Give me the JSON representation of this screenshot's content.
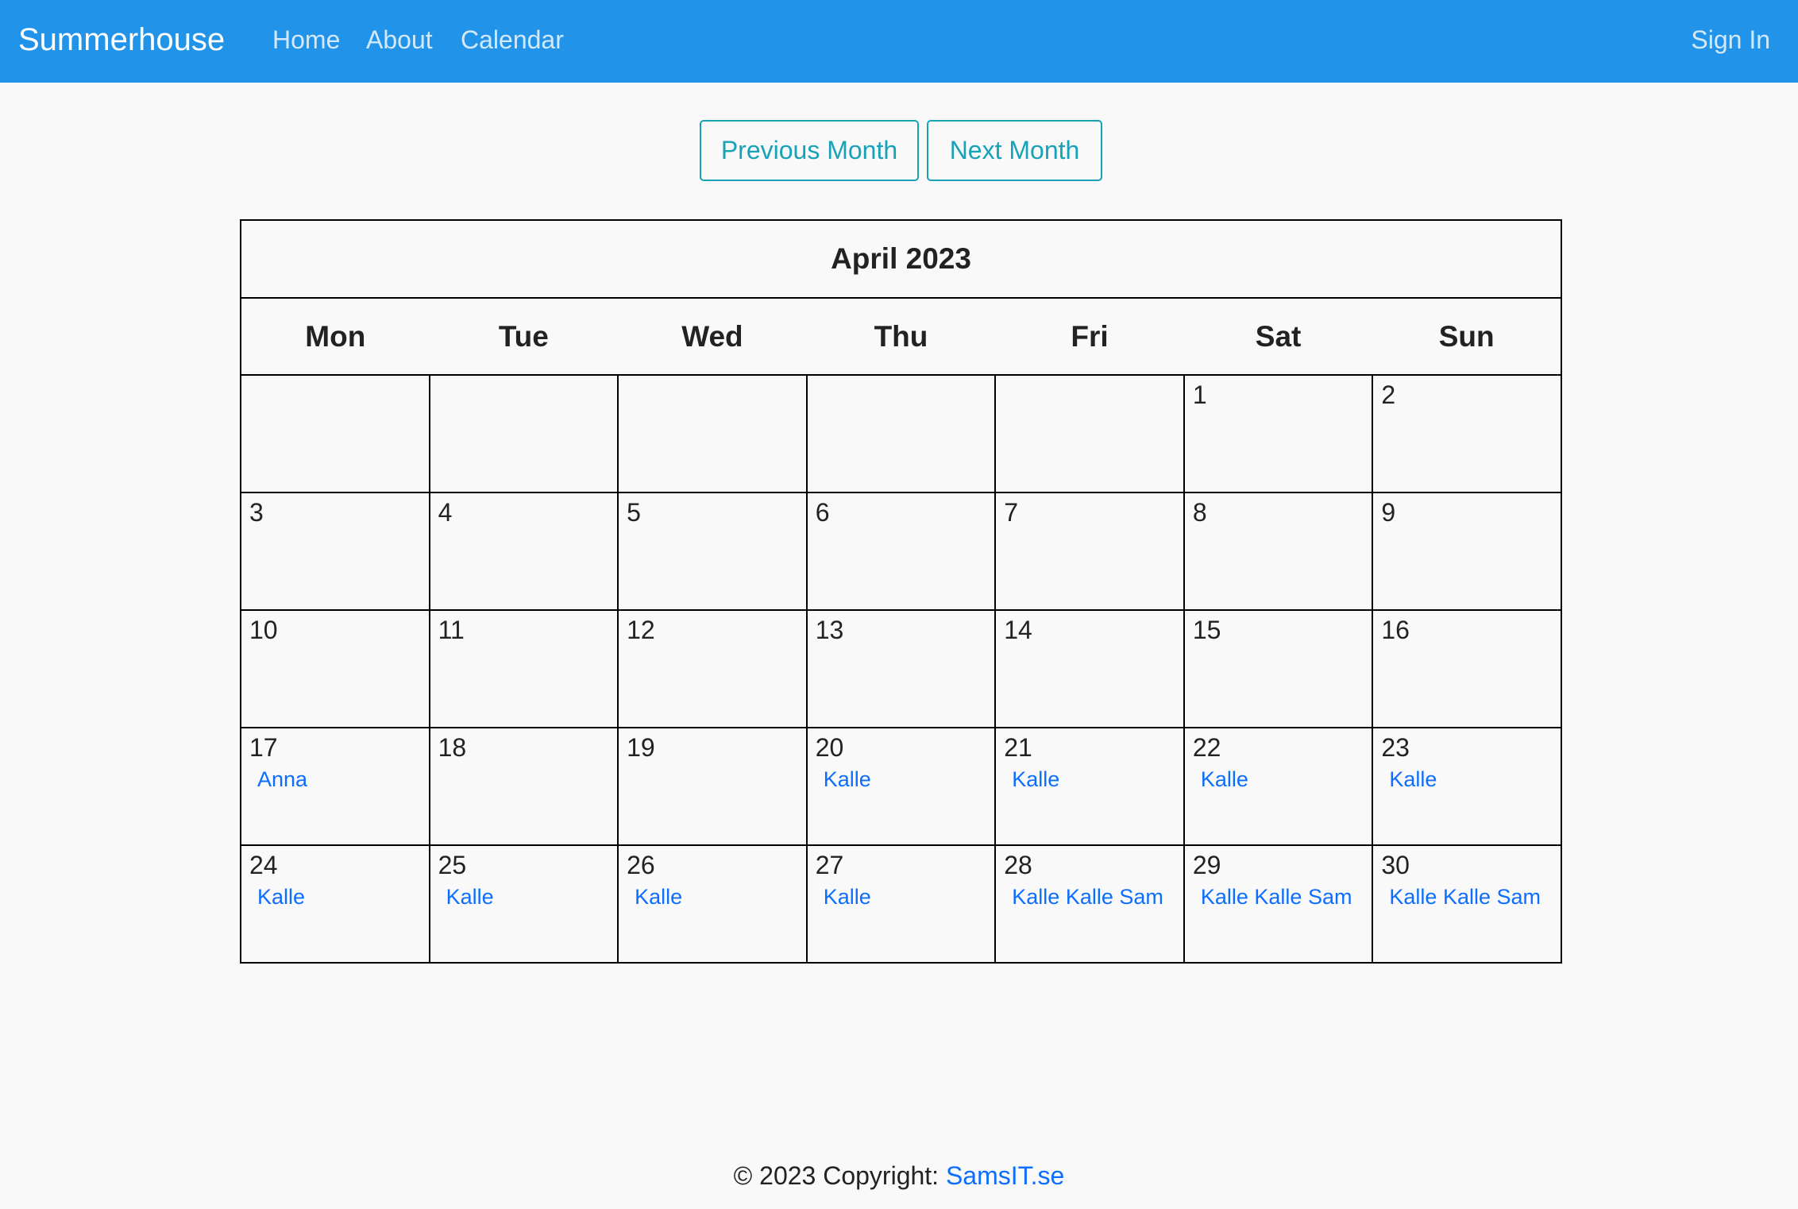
{
  "navbar": {
    "brand": "Summerhouse",
    "links": [
      "Home",
      "About",
      "Calendar"
    ],
    "sign_in": "Sign In",
    "background_color": "#2193e8"
  },
  "month_nav": {
    "previous_label": "Previous Month",
    "next_label": "Next Month",
    "button_color": "#17a2b8"
  },
  "calendar": {
    "title": "April 2023",
    "weekdays": [
      "Mon",
      "Tue",
      "Wed",
      "Thu",
      "Fri",
      "Sat",
      "Sun"
    ],
    "weeks": [
      [
        {
          "day": "",
          "bookings": []
        },
        {
          "day": "",
          "bookings": []
        },
        {
          "day": "",
          "bookings": []
        },
        {
          "day": "",
          "bookings": []
        },
        {
          "day": "",
          "bookings": []
        },
        {
          "day": "1",
          "bookings": []
        },
        {
          "day": "2",
          "bookings": []
        }
      ],
      [
        {
          "day": "3",
          "bookings": []
        },
        {
          "day": "4",
          "bookings": []
        },
        {
          "day": "5",
          "bookings": []
        },
        {
          "day": "6",
          "bookings": []
        },
        {
          "day": "7",
          "bookings": []
        },
        {
          "day": "8",
          "bookings": []
        },
        {
          "day": "9",
          "bookings": []
        }
      ],
      [
        {
          "day": "10",
          "bookings": []
        },
        {
          "day": "11",
          "bookings": []
        },
        {
          "day": "12",
          "bookings": []
        },
        {
          "day": "13",
          "bookings": []
        },
        {
          "day": "14",
          "bookings": []
        },
        {
          "day": "15",
          "bookings": []
        },
        {
          "day": "16",
          "bookings": []
        }
      ],
      [
        {
          "day": "17",
          "bookings": [
            "Anna"
          ]
        },
        {
          "day": "18",
          "bookings": []
        },
        {
          "day": "19",
          "bookings": []
        },
        {
          "day": "20",
          "bookings": [
            "Kalle"
          ]
        },
        {
          "day": "21",
          "bookings": [
            "Kalle"
          ]
        },
        {
          "day": "22",
          "bookings": [
            "Kalle"
          ]
        },
        {
          "day": "23",
          "bookings": [
            "Kalle"
          ]
        }
      ],
      [
        {
          "day": "24",
          "bookings": [
            "Kalle"
          ]
        },
        {
          "day": "25",
          "bookings": [
            "Kalle"
          ]
        },
        {
          "day": "26",
          "bookings": [
            "Kalle"
          ]
        },
        {
          "day": "27",
          "bookings": [
            "Kalle"
          ]
        },
        {
          "day": "28",
          "bookings": [
            "Kalle",
            "Kalle",
            "Sam"
          ]
        },
        {
          "day": "29",
          "bookings": [
            "Kalle",
            "Kalle",
            "Sam"
          ]
        },
        {
          "day": "30",
          "bookings": [
            "Kalle",
            "Kalle",
            "Sam"
          ]
        }
      ]
    ],
    "booking_color": "#0d6efd"
  },
  "footer": {
    "text": "© 2023 Copyright: ",
    "link": "SamsIT.se"
  }
}
